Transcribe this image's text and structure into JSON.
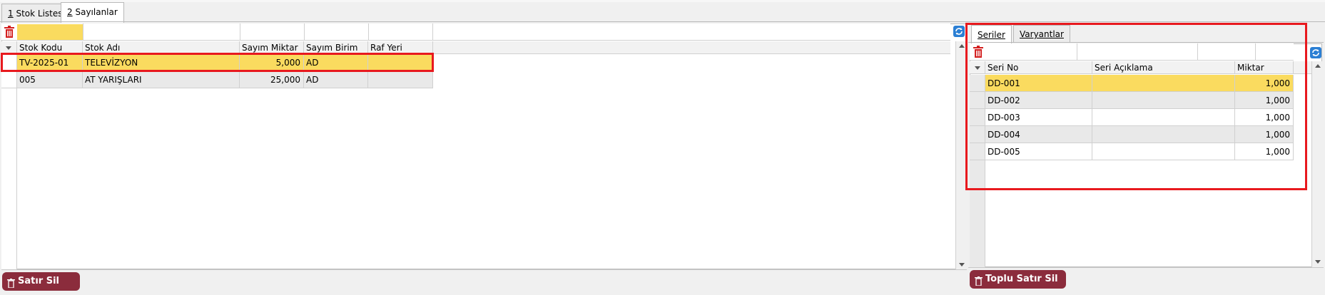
{
  "tabs": [
    {
      "key": "1",
      "label": "Stok Listesi"
    },
    {
      "key": "2",
      "label": "Sayılanlar"
    }
  ],
  "left_grid": {
    "columns": [
      "Stok Kodu",
      "Stok Adı",
      "Sayım Miktar",
      "Sayım Birim",
      "Raf Yeri"
    ],
    "rows": [
      {
        "stok_kodu": "TV-2025-01",
        "stok_adi": "TELEVİZYON",
        "sayim_miktar": "5,000",
        "sayim_birim": "AD",
        "raf_yeri": ""
      },
      {
        "stok_kodu": "005",
        "stok_adi": "AT YARIŞLARI",
        "sayim_miktar": "25,000",
        "sayim_birim": "AD",
        "raf_yeri": ""
      }
    ],
    "delete_button": "Satır Sil"
  },
  "right_panel": {
    "tabs": [
      "Seriler",
      "Varyantlar"
    ],
    "columns": [
      "Seri No",
      "Seri Açıklama",
      "Miktar"
    ],
    "rows": [
      {
        "seri_no": "DD-001",
        "aciklama": "",
        "miktar": "1,000"
      },
      {
        "seri_no": "DD-002",
        "aciklama": "",
        "miktar": "1,000"
      },
      {
        "seri_no": "DD-003",
        "aciklama": "",
        "miktar": "1,000"
      },
      {
        "seri_no": "DD-004",
        "aciklama": "",
        "miktar": "1,000"
      },
      {
        "seri_no": "DD-005",
        "aciklama": "",
        "miktar": "1,000"
      }
    ],
    "delete_button": "Toplu Satır Sil"
  },
  "colors": {
    "selected_row": "#fadb5f",
    "button": "#8b2c3c",
    "highlight": "#e8191e"
  }
}
